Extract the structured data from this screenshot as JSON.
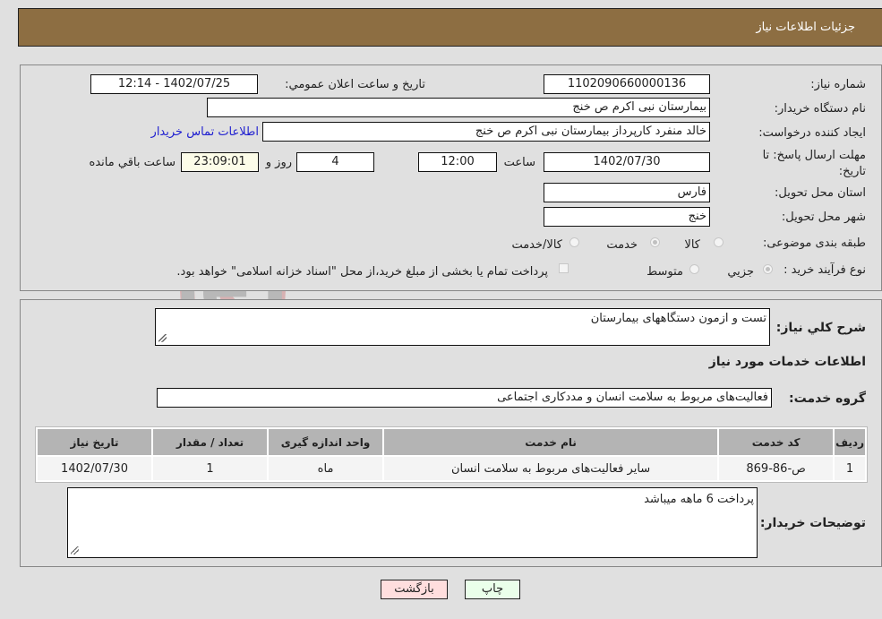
{
  "header": {
    "title": "جزئیات اطلاعات نیاز"
  },
  "form": {
    "need_number": {
      "label": "شماره نیاز:",
      "value": "1102090660000136"
    },
    "announce_datetime": {
      "label": "تاریخ و ساعت اعلان عمومي:",
      "value": "1402/07/25 - 12:14"
    },
    "buyer_org": {
      "label": "نام دستگاه خریدار:",
      "value": "بیمارستان نبی اکرم  ص  خنج"
    },
    "requester": {
      "label": "ایجاد کننده درخواست:",
      "value": "خالد منفرد کارپرداز بیمارستان نبی اکرم  ص  خنج"
    },
    "buyer_contact_link": "اطلاعات تماس خریدار",
    "deadline": {
      "label": "مهلت ارسال پاسخ: تا تاریخ:",
      "date": "1402/07/30",
      "time_label": "ساعت",
      "time": "12:00",
      "days": "4",
      "days_label": "روز و",
      "remaining": "23:09:01",
      "remaining_label": "ساعت باقي مانده"
    },
    "province": {
      "label": "استان محل تحویل:",
      "value": "فارس"
    },
    "city": {
      "label": "شهر محل تحویل:",
      "value": "خنج"
    },
    "category": {
      "label": "طبقه بندی موضوعی:",
      "options": [
        {
          "label": "کالا",
          "selected": false
        },
        {
          "label": "خدمت",
          "selected": true
        },
        {
          "label": "کالا/خدمت",
          "selected": false
        }
      ]
    },
    "purchase_type": {
      "label": "نوع فرآیند خرید :",
      "options": [
        {
          "label": "جزيي",
          "selected": true
        },
        {
          "label": "متوسط",
          "selected": false
        }
      ],
      "treasury_checkbox": {
        "label": "پرداخت تمام یا بخشی از مبلغ خرید،از محل \"اسناد خزانه اسلامی\" خواهد بود.",
        "checked": false
      }
    }
  },
  "details": {
    "description_label": "شرح کلي نیاز:",
    "description_value": "تست و ازمون دستگاههای بیمارستان",
    "services_title": "اطلاعات خدمات مورد نیاز",
    "service_group_label": "گروه خدمت:",
    "service_group_value": "فعالیت‌های مربوط به سلامت انسان و مددکاری اجتماعی",
    "table": {
      "headers": [
        "ردیف",
        "کد خدمت",
        "نام خدمت",
        "واحد اندازه گیری",
        "تعداد / مقدار",
        "تاریخ نیاز"
      ],
      "rows": [
        [
          "1",
          "ص-86-869",
          "سایر فعالیت‌های مربوط به سلامت انسان",
          "ماه",
          "1",
          "1402/07/30"
        ]
      ]
    },
    "buyer_notes_label": "توضیحات خریدار:",
    "buyer_notes_value": "پرداخت 6 ماهه میباشد"
  },
  "buttons": {
    "print": "چاپ",
    "back": "بازگشت"
  },
  "watermark": "AriaTender.neT",
  "colors": {
    "header_bg": "#8d6e42",
    "print_bg": "#eaffea",
    "back_bg": "#ffdede",
    "link": "#2020d0"
  }
}
